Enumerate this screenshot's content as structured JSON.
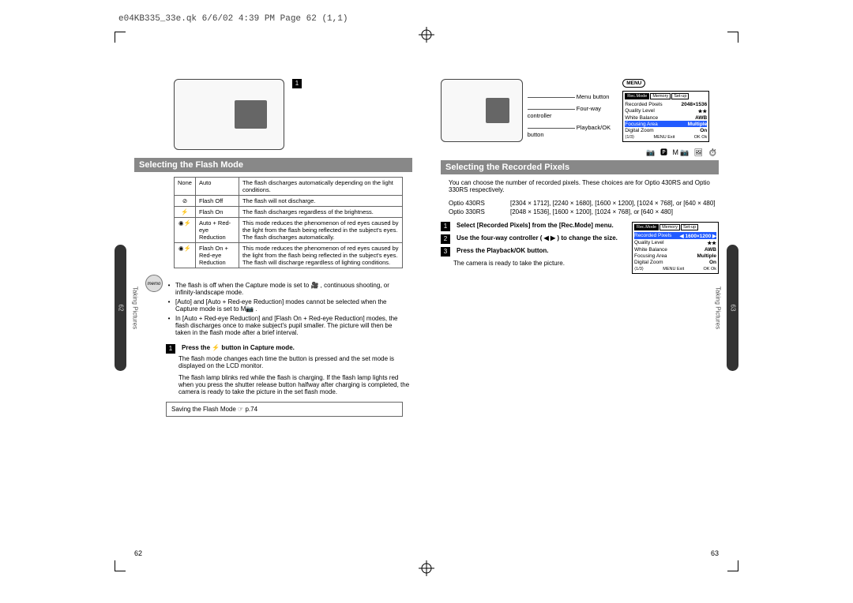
{
  "header_line": "e04KB335_33e.qk  6/6/02 4:39 PM  Page 62 (1,1)",
  "side_label": "Taking Pictures",
  "thumb_index": "3",
  "left_page": {
    "page_num": "62",
    "step_marker": "1",
    "camera_alt": "camera back",
    "section_title": "Selecting the Flash Mode",
    "table": [
      {
        "icon": "None",
        "mode": "Auto",
        "desc": "The flash discharges automatically depending on the light conditions."
      },
      {
        "icon": "⊘",
        "mode": "Flash Off",
        "desc": "The flash will not discharge."
      },
      {
        "icon": "⚡",
        "mode": "Flash On",
        "desc": "The flash discharges regardless of the brightness."
      },
      {
        "icon": "◉⚡",
        "mode": "Auto + Red-eye Reduction",
        "desc": "This mode reduces the phenomenon of red eyes caused by the light from the flash being reflected in the subject's eyes. The flash discharges automatically."
      },
      {
        "icon": "◉⚡",
        "mode": "Flash On + Red-eye Reduction",
        "desc": "This mode reduces the phenomenon of red eyes caused by the light from the flash being reflected in the subject's eyes. The flash will discharge regardless of lighting conditions."
      }
    ],
    "memo_label": "memo",
    "bullets": [
      "The flash is off when the Capture mode is set to 🎥 , continuous shooting, or infinity-landscape mode.",
      "[Auto] and [Auto + Red-eye Reduction] modes cannot be selected when the Capture mode is set to M📷 .",
      "In [Auto + Red-eye Reduction] and [Flash On + Red-eye Reduction] modes, the flash discharges once to make subject's pupil smaller. The picture will then be taken in the flash mode after a brief interval."
    ],
    "step1": "Press the  ⚡  button in Capture mode.",
    "step1_body1": "The flash mode changes each time the button is pressed and the set mode is displayed on the LCD monitor.",
    "step1_body2": "The flash lamp blinks red while the flash is charging. If the flash lamp lights red when you press the shutter release button halfway after charging is completed, the camera is ready to take the picture in the set flash mode.",
    "xref": "Saving the Flash Mode ☞ p.74"
  },
  "right_page": {
    "page_num": "63",
    "camera_alt": "camera back",
    "callouts": {
      "menu_button": "Menu button",
      "fourway": "Four-way controller",
      "playback": "Playback/OK button"
    },
    "menu_button_label": "MENU",
    "mode_icons": "📷 🅿 M📷 🖼 ⏱",
    "section_title": "Selecting the Recorded Pixels",
    "intro": "You can choose the number of recorded pixels. These choices are for Optio 430RS and Optio 330RS respectively.",
    "specs": [
      {
        "model": "Optio 430RS",
        "vals": "[2304 × 1712], [2240 × 1680], [1600 × 1200], [1024 × 768], or [640 × 480]"
      },
      {
        "model": "Optio 330RS",
        "vals": "[2048 × 1536], [1600 × 1200], [1024 × 768], or [640 × 480]"
      }
    ],
    "steps": [
      "Select [Recorded Pixels] from the [Rec.Mode] menu.",
      "Use the four-way controller ( ◀ ▶ ) to change the size.",
      "Press the Playback/OK button."
    ],
    "step3_body": "The camera is ready to take the picture.",
    "menu1": {
      "tabs": [
        "Rec.Mode",
        "Memory",
        "Set-up"
      ],
      "rows": [
        {
          "k": "Recorded Pixels",
          "v": "2048×1536",
          "hl": false
        },
        {
          "k": "Quality Level",
          "v": "★★",
          "hl": false
        },
        {
          "k": "White Balance",
          "v": "AWB",
          "hl": false
        },
        {
          "k": "Focusing Area",
          "v": "Multiple",
          "hl": true
        },
        {
          "k": "Digital Zoom",
          "v": "On",
          "hl": false
        }
      ],
      "footer_left": "⟨1/3⟩",
      "footer_mid": "MENU Exit",
      "footer_right": "OK Ok"
    },
    "menu2": {
      "tabs": [
        "Rec.Mode",
        "Memory",
        "Set-up"
      ],
      "rows": [
        {
          "k": "Recorded Pixels",
          "v": "◀ 1600×1200 ▶",
          "hl": true
        },
        {
          "k": "Quality Level",
          "v": "★★",
          "hl": false
        },
        {
          "k": "White Balance",
          "v": "AWB",
          "hl": false
        },
        {
          "k": "Focusing Area",
          "v": "Multiple",
          "hl": false
        },
        {
          "k": "Digital Zoom",
          "v": "On",
          "hl": false
        }
      ],
      "footer_left": "⟨1/3⟩",
      "footer_mid": "MENU Exit",
      "footer_right": "OK Ok"
    }
  }
}
